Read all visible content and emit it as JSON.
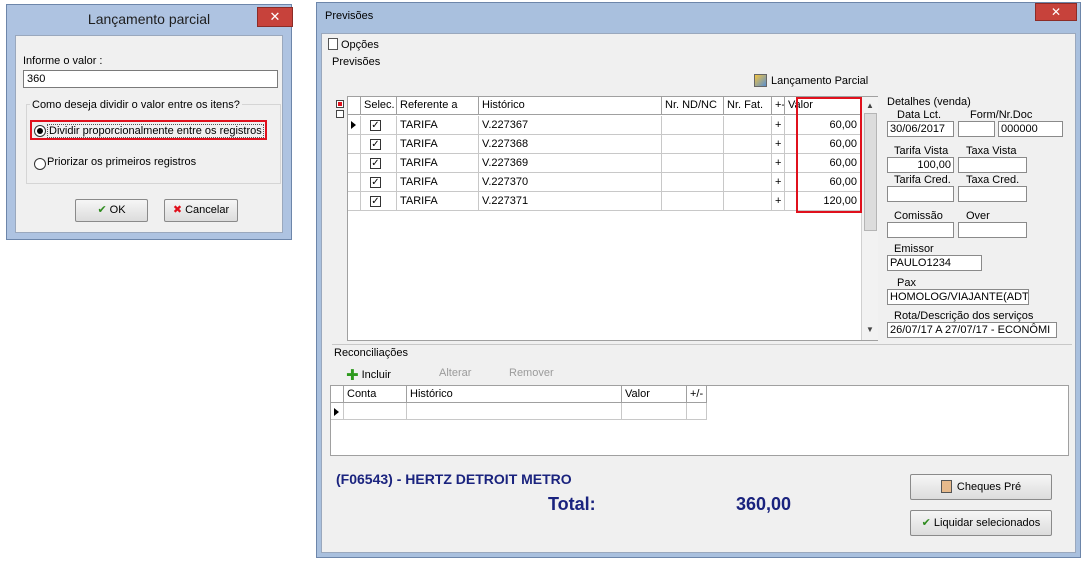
{
  "dialog": {
    "title": "Lançamento parcial",
    "close_glyph": "✕",
    "value_label": "Informe o valor :",
    "value": "360",
    "group_label": "Como deseja dividir o valor entre os itens?",
    "option1": "Dividir proporcionalmente entre os registros",
    "option2": "Priorizar os primeiros registros",
    "ok_label": "OK",
    "cancel_label": "Cancelar"
  },
  "window": {
    "title": "Previsões",
    "close_glyph": "✕",
    "menu_options": "Opções",
    "section_label": "Previsões",
    "lanc_parcial_label": "Lançamento Parcial",
    "grid": {
      "headers": [
        "Selec.",
        "Referente a",
        "Histórico",
        "Nr. ND/NC",
        "Nr. Fat.",
        "+-",
        "Valor"
      ],
      "rows": [
        {
          "selected": true,
          "ref": "TARIFA",
          "historico": "V.227367",
          "nd": "",
          "fat": "",
          "sign": "+",
          "valor": "60,00"
        },
        {
          "selected": true,
          "ref": "TARIFA",
          "historico": "V.227368",
          "nd": "",
          "fat": "",
          "sign": "+",
          "valor": "60,00"
        },
        {
          "selected": true,
          "ref": "TARIFA",
          "historico": "V.227369",
          "nd": "",
          "fat": "",
          "sign": "+",
          "valor": "60,00"
        },
        {
          "selected": true,
          "ref": "TARIFA",
          "historico": "V.227370",
          "nd": "",
          "fat": "",
          "sign": "+",
          "valor": "60,00"
        },
        {
          "selected": true,
          "ref": "TARIFA",
          "historico": "V.227371",
          "nd": "",
          "fat": "",
          "sign": "+",
          "valor": "120,00"
        }
      ]
    },
    "details": {
      "header": "Detalhes (venda)",
      "data_lct_label": "Data Lct.",
      "data_lct": "30/06/2017",
      "form_nr_doc_label": "Form/Nr.Doc",
      "form_nr_doc": "000000",
      "tarifa_vista_label": "Tarifa Vista",
      "tarifa_vista": "100,00",
      "taxa_vista_label": "Taxa Vista",
      "taxa_vista": "",
      "tarifa_cred_label": "Tarifa Cred.",
      "tarifa_cred": "",
      "taxa_cred_label": "Taxa Cred.",
      "taxa_cred": "",
      "comissao_label": "Comissão",
      "comissao": "",
      "over_label": "Over",
      "over": "",
      "emissor_label": "Emissor",
      "emissor": "PAULO1234",
      "pax_label": "Pax",
      "pax": "HOMOLOG/VIAJANTE(ADT)",
      "rota_label": "Rota/Descrição dos serviços",
      "rota": "26/07/17 A 27/07/17 - ECONÔMI"
    },
    "reconciliations": {
      "title": "Reconciliações",
      "incluir": "Incluir",
      "alterar": "Alterar",
      "remover": "Remover",
      "headers": [
        "Conta",
        "Histórico",
        "Valor",
        "+/-"
      ]
    },
    "supplier": "(F06543) - HERTZ DETROIT METRO",
    "total_label": "Total:",
    "total_value": "360,00",
    "cheques_label": "Cheques Pré",
    "liquidar_label": "Liquidar selecionados"
  }
}
